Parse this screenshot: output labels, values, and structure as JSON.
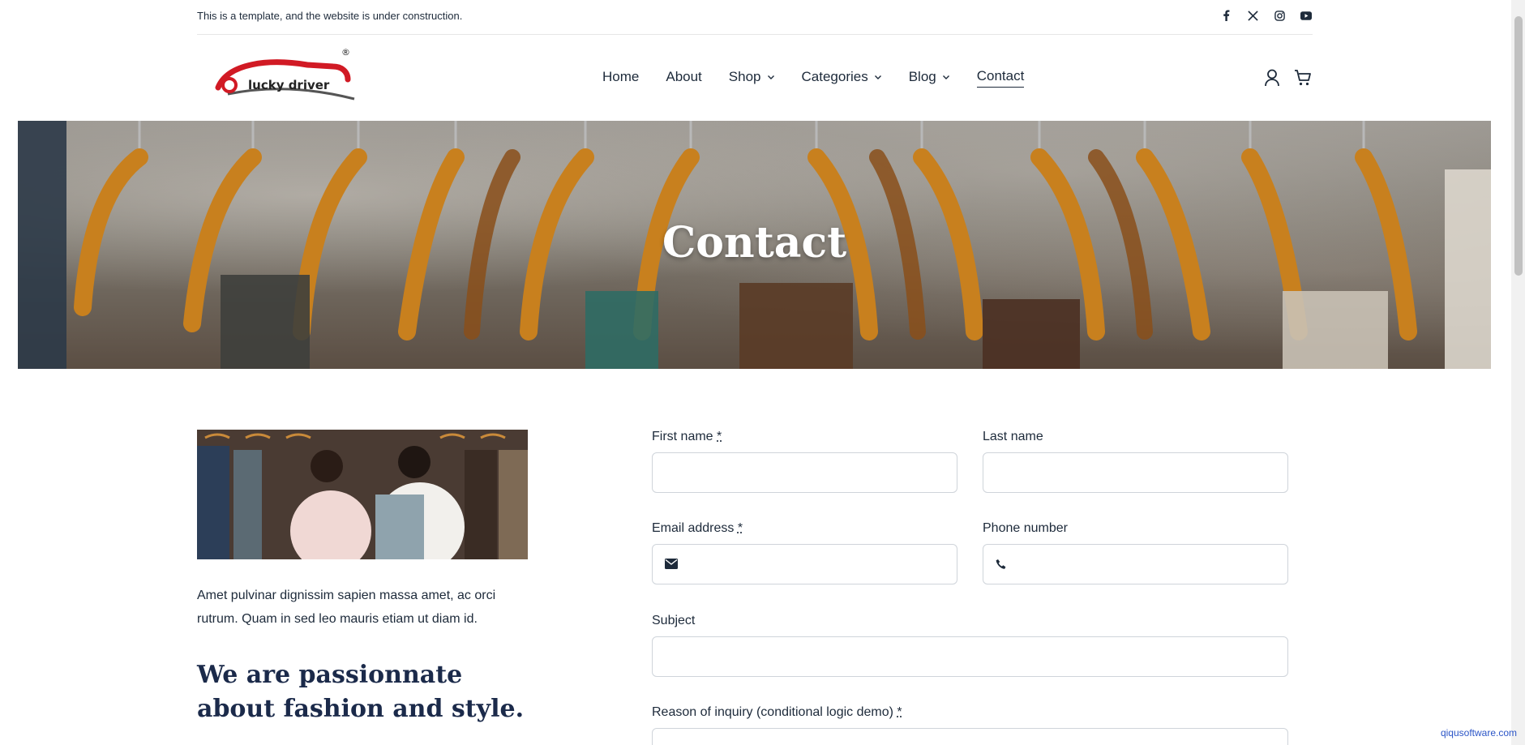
{
  "topbar": {
    "notice": "This is a template, and the website is under construction.",
    "social": [
      "facebook-icon",
      "x-icon",
      "instagram-icon",
      "youtube-icon"
    ]
  },
  "logo": {
    "text": "lucky driver",
    "mark": "®"
  },
  "nav": {
    "items": [
      {
        "label": "Home",
        "dropdown": false
      },
      {
        "label": "About",
        "dropdown": false
      },
      {
        "label": "Shop",
        "dropdown": true
      },
      {
        "label": "Categories",
        "dropdown": true
      },
      {
        "label": "Blog",
        "dropdown": true
      },
      {
        "label": "Contact",
        "dropdown": false,
        "active": true
      }
    ]
  },
  "header_icons": [
    "user-icon",
    "cart-icon"
  ],
  "hero": {
    "title": "Contact"
  },
  "side": {
    "text": "Amet pulvinar dignissim sapien massa amet, ac orci rutrum. Quam in sed leo mauris etiam ut diam id.",
    "heading": "We are passionnate about fashion and style."
  },
  "form": {
    "first_name_label": "First name",
    "last_name_label": "Last name",
    "email_label": "Email address",
    "phone_label": "Phone number",
    "subject_label": "Subject",
    "reason_label": "Reason of inquiry (conditional logic demo)",
    "required_mark": "*"
  },
  "watermark": "qiqusoftware.com",
  "colors": {
    "text": "#1d2a3a",
    "heading": "#1b2a4a",
    "logo_red": "#d11a24"
  }
}
